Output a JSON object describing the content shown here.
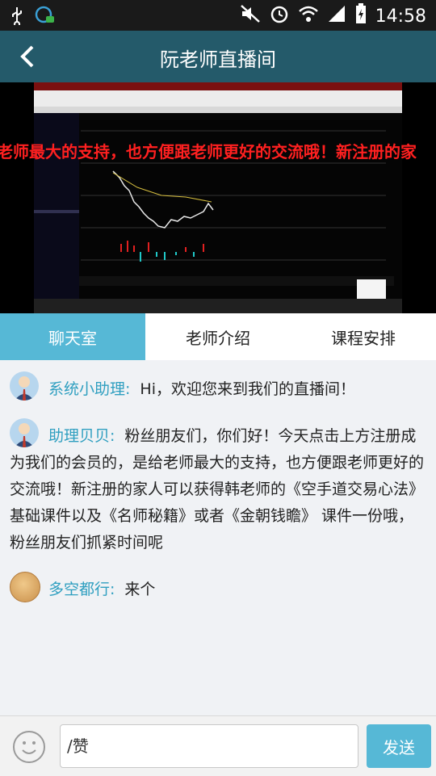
{
  "status_bar": {
    "time": "14:58"
  },
  "header": {
    "title": "阮老师直播间"
  },
  "video": {
    "marquee": "老师最大的支持，也方便跟老师更好的交流哦！新注册的家"
  },
  "tabs": [
    {
      "label": "聊天室",
      "active": true
    },
    {
      "label": "老师介绍",
      "active": false
    },
    {
      "label": "课程安排",
      "active": false
    }
  ],
  "messages": [
    {
      "sender": "系统小助理:",
      "text": "Hi，欢迎您来到我们的直播间！",
      "avatar": "person-icon"
    },
    {
      "sender": "助理贝贝:",
      "text": "粉丝朋友们，你们好！今天点击上方注册成为我们的会员的，是给老师最大的支持，也方便跟老师更好的交流哦！新注册的家人可以获得韩老师的《空手道交易心法》基础课件以及《名师秘籍》或者《金朝钱瞻》 课件一份哦，粉丝朋友们抓紧时间呢",
      "avatar": "person-icon"
    },
    {
      "sender": "多空都行:",
      "text": "来个",
      "avatar": "coin-icon"
    }
  ],
  "input": {
    "value": "/赞"
  },
  "send_button": {
    "label": "发送"
  },
  "colors": {
    "header": "#245a6a",
    "accent": "#56b8d6",
    "sender": "#2f9fc0"
  }
}
